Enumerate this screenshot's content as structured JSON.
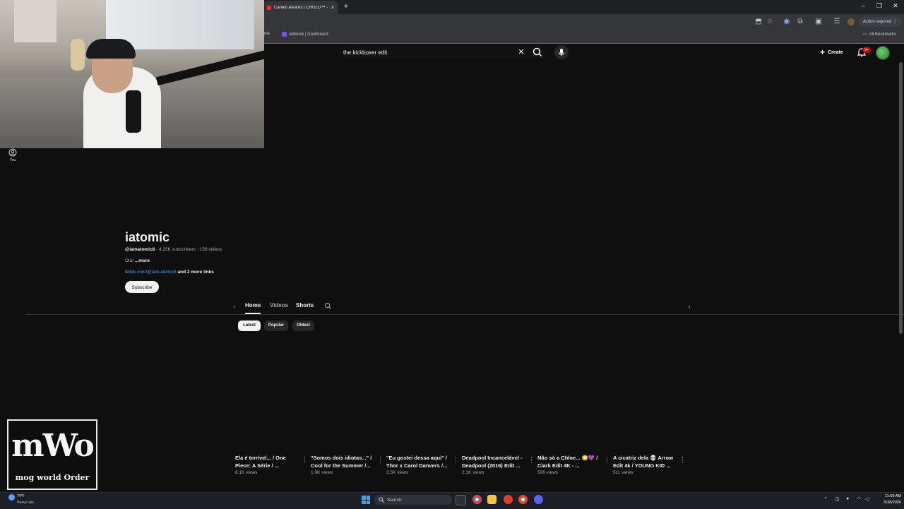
{
  "browser": {
    "active_tab_title": "Canelo Alvarez | CHOLO™ - Yo",
    "bookmarks": [
      {
        "label": "Home"
      },
      {
        "label": "sidekick | Dashboard"
      }
    ],
    "all_bookmarks_label": "All Bookmarks",
    "action_required_label": "Action required"
  },
  "youtube": {
    "search_query": "the kickboxer edit",
    "create_label": "Create",
    "notification_badge": "9+",
    "sidebar_you_label": "You"
  },
  "channel": {
    "name": "iatomic",
    "handle": "@iamatomic8",
    "subscribers": "4.25K subscribers",
    "videos": "159 videos",
    "description": "Olá!",
    "description_more": "...more",
    "link": "tiktok.com/@iam.atomic8",
    "more_links": "and 2 more links",
    "subscribe_label": "Subscribe"
  },
  "tabs": [
    {
      "label": "Home"
    },
    {
      "label": "Videos"
    },
    {
      "label": "Shorts"
    }
  ],
  "chips": [
    {
      "label": "Latest"
    },
    {
      "label": "Popular"
    },
    {
      "label": "Oldest"
    }
  ],
  "shorts": [
    {
      "title": "Ela é terrível... / One Piece: A Série / ...",
      "views": "8.1K views"
    },
    {
      "title": "\"Somos dois idiotas...\" / Cool for the Summer /...",
      "views": "1.9K views"
    },
    {
      "title": "\"Eu gostei dessa aqui\" / Thor x Carol Danvers /...",
      "views": "2.5K views"
    },
    {
      "title": "Deadpool Incancelável - Deadpool (2016) Edit ...",
      "views": "2.1K views"
    },
    {
      "title": "Não só a Chloe... 😳💜 / Clark Edit 4K - ...",
      "views": "506 views"
    },
    {
      "title": "A cicatriz dela 💀 Arrow Edit  4k / YOUNG KID ...",
      "views": "511 views"
    }
  ],
  "logo": {
    "big_text": "mWo",
    "sub_text": "mog world Order"
  },
  "taskbar": {
    "weather_temp": "74°F",
    "weather_cond": "Heavy rain",
    "search_label": "Search",
    "time": "11:59 AM",
    "date": "5/28/2026"
  }
}
